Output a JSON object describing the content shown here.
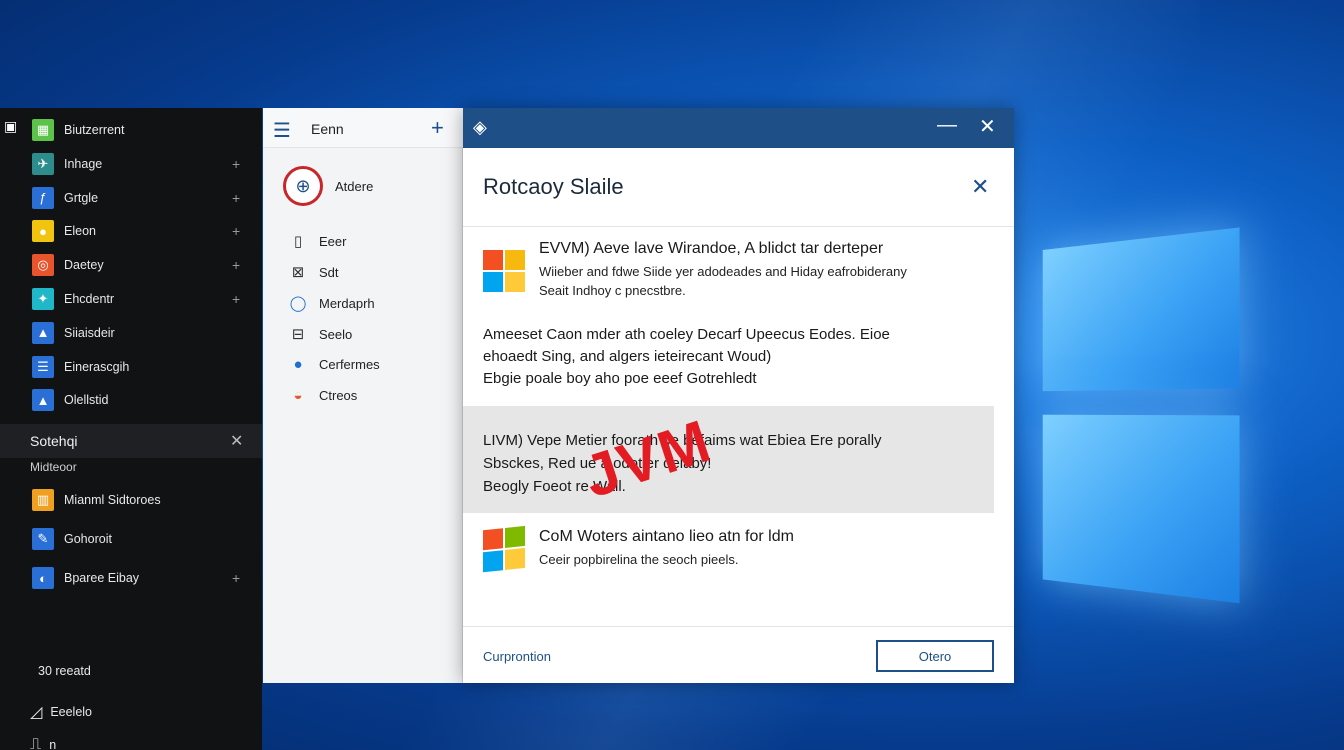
{
  "start_menu": {
    "apps": [
      {
        "label": "Biutzerrent",
        "color": "#5cc249",
        "glyph": "▦",
        "chevron": ""
      },
      {
        "label": "Inhage",
        "color": "#2d8d8d",
        "glyph": "✈",
        "chevron": "+"
      },
      {
        "label": "Grtgle",
        "color": "#2a6fd6",
        "glyph": "ƒ",
        "chevron": "+"
      },
      {
        "label": "Eleon",
        "color": "#f1c40f",
        "glyph": "●",
        "chevron": "+"
      },
      {
        "label": "Daetey",
        "color": "#e8542c",
        "glyph": "◎",
        "chevron": "+"
      },
      {
        "label": "Ehcdentr",
        "color": "#20b8c9",
        "glyph": "✦",
        "chevron": "+"
      },
      {
        "label": "Siiaisdeir",
        "color": "#2a6fd6",
        "glyph": "▲",
        "chevron": ""
      },
      {
        "label": "Einerascgih",
        "color": "#2a6fd6",
        "glyph": "☰",
        "chevron": ""
      },
      {
        "label": "Olellstid",
        "color": "#2a6fd6",
        "glyph": "▲",
        "chevron": ""
      }
    ],
    "group": {
      "label": "Sotehqi",
      "sub_label": "Midteoor"
    },
    "group_apps": [
      {
        "label": "Mianml Sidtoroes",
        "color": "#f0a020",
        "glyph": "▥",
        "chevron": ""
      },
      {
        "label": "Gohoroit",
        "color": "#2a6fd6",
        "glyph": "✎",
        "chevron": ""
      },
      {
        "label": "Bparee Eibay",
        "color": "#2a6fd6",
        "glyph": "◐",
        "chevron": "+"
      }
    ],
    "bottom": [
      {
        "label": "30 reeatd",
        "glyph": ""
      },
      {
        "label": "Eeelelo",
        "glyph": "◿"
      },
      {
        "label": "n",
        "glyph": "⎍"
      }
    ]
  },
  "mid_pane": {
    "title": "Eenn",
    "user_name": "Atdere",
    "items": [
      {
        "label": "Eeer",
        "glyph": "▯",
        "color": "#333333"
      },
      {
        "label": "Sdt",
        "glyph": "⊠",
        "color": "#333333"
      },
      {
        "label": "Merdaprh",
        "glyph": "◯",
        "color": "#1e6fd0"
      },
      {
        "label": "Seelo",
        "glyph": "⊟",
        "color": "#333333"
      },
      {
        "label": "Cerfermes",
        "glyph": "●",
        "color": "#1e6fd0"
      },
      {
        "label": "Ctreos",
        "glyph": "◒",
        "color": "#e8542c"
      }
    ]
  },
  "dialog": {
    "title": "Rotcaoy Slaile",
    "section1": {
      "title": "EVVM) Aeve lave Wirandoe, A blidct tar derteper",
      "line1": "Wiieber and fdwe Siide yer adodeades and Hiday eafrobiderany",
      "line2": "Seait Indhoy c pnecstbre."
    },
    "section2": {
      "line1": "Ameeset Caon mder ath coeley Decarf Upeecus Eodes. Eioe",
      "line2": "ehoaedt Sing, and algers ieteirecant Woud)",
      "line3": "Ebgie poale boy aho poe eeef Gotrehledt"
    },
    "section3": {
      "line1": "LIVM) Vepe Metier foorath pe befaims wat Ebiea Ere porally",
      "line2": "Sbsckes, Red               ue a odotler delaby!",
      "line3": "Beogly Foeot             re Wall."
    },
    "stamp": "JVM",
    "section4": {
      "title": "CoM Woters aintano lieo atn for ldm",
      "line1": "Ceeir popbirelina the seoch pieels."
    },
    "footer_link": "Curprontion",
    "footer_button": "Otero"
  }
}
